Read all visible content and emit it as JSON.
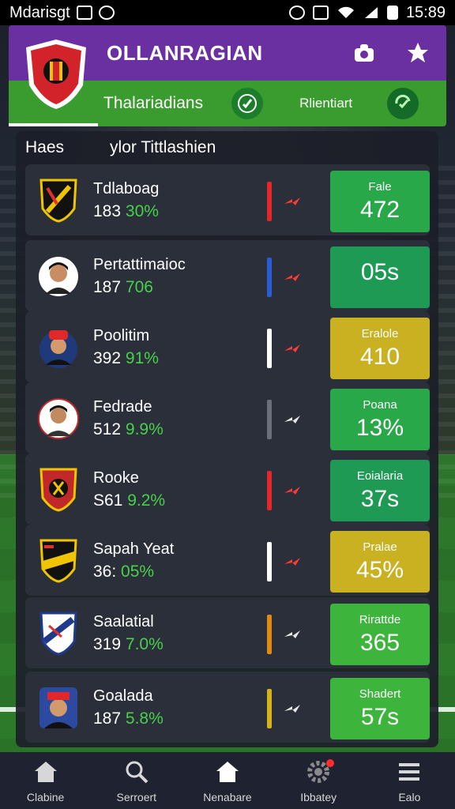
{
  "status_bar": {
    "app_name": "Mdarisgt",
    "time": "15:89"
  },
  "header": {
    "title": "OLLANRAGIAN",
    "sub_label_primary": "Thalariadians",
    "sub_label_secondary": "Rlientiart"
  },
  "list_header": {
    "col1": "Haes",
    "col2": "ylor Tittlashien"
  },
  "rows": [
    {
      "name": "Tdlaboag",
      "num": "183",
      "pct": "30%",
      "score_label": "Fale",
      "score_value": "472"
    },
    {
      "name": "Pertattimaioc",
      "num": "187",
      "pct": "706",
      "score_label": "",
      "score_value": "05s"
    },
    {
      "name": "Poolitim",
      "num": "392",
      "pct": "91%",
      "score_label": "Eralole",
      "score_value": "410"
    },
    {
      "name": "Fedrade",
      "num": "512",
      "pct": "9.9%",
      "score_label": "Poana",
      "score_value": "13%"
    },
    {
      "name": "Rooke",
      "num": "S61",
      "pct": "9.2%",
      "score_label": "Eoialaria",
      "score_value": "37s"
    },
    {
      "name": "Sapah Yeat",
      "num": "36:",
      "pct": "05%",
      "score_label": "Pralae",
      "score_value": "45%"
    },
    {
      "name": "Saalatial",
      "num": "319",
      "pct": "7.0%",
      "score_label": "Rirattde",
      "score_value": "365"
    },
    {
      "name": "Goalada",
      "num": "187",
      "pct": "5.8%",
      "score_label": "Shadert",
      "score_value": "57s"
    }
  ],
  "nav": {
    "item1": "Clabine",
    "item2": "Serroert",
    "item3": "Nenabare",
    "item4": "Ibbatey",
    "item5": "Ealo"
  },
  "colors": {
    "purple": "#6a2fa0",
    "green_header": "#3a9c2e",
    "score_green": "#29a84a",
    "score_lime": "#3db43b",
    "score_yellow": "#c9b122",
    "bar_red": "#e0282a",
    "bar_blue": "#2b5cd6",
    "bar_white": "#ffffff",
    "bar_gray": "#6b6f78",
    "bar_orange": "#e08a13",
    "bar_yellow": "#d5b21a",
    "trend_red": "#ff3b3b",
    "trend_white": "#e8e8e8"
  },
  "icons": {
    "header_action1": "camera-icon",
    "header_action2": "star-icon",
    "header_circle1": "slash-check-icon",
    "header_circle2": "refresh-check-icon",
    "nav1": "home-icon",
    "nav2": "search-icon",
    "nav3": "home-icon",
    "nav4": "gear-icon",
    "nav5": "menu-icon"
  }
}
